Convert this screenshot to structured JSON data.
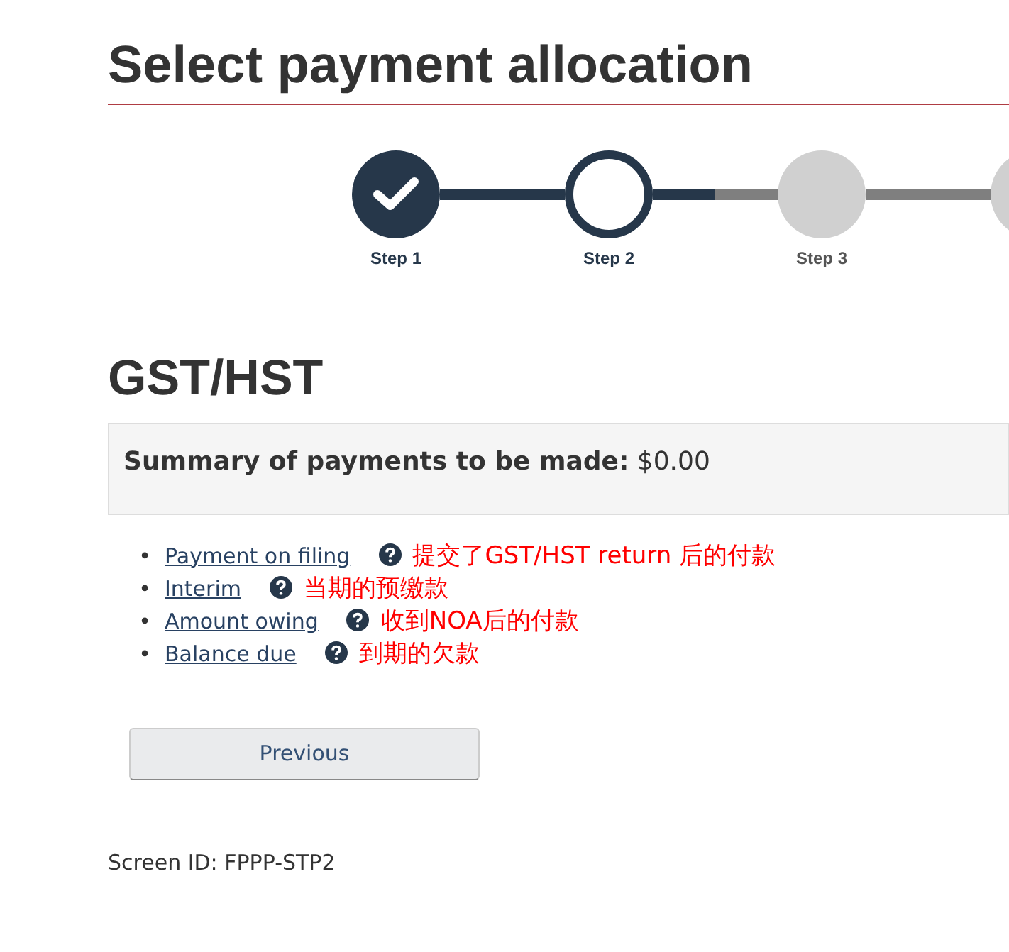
{
  "title": "Select payment allocation",
  "steps": [
    {
      "label": "Step 1",
      "completed": true,
      "reached": true
    },
    {
      "label": "Step 2",
      "completed": false,
      "reached": true
    },
    {
      "label": "Step 3",
      "completed": false,
      "reached": false
    },
    {
      "completed": false,
      "reached": false
    }
  ],
  "section_title": "GST/HST",
  "summary": {
    "label": "Summary of payments to be made:",
    "amount": "$0.00"
  },
  "payment_types": [
    {
      "bullet": "•",
      "label": "Payment on filing",
      "note": "提交了GST/HST return 后的付款"
    },
    {
      "bullet": "•",
      "label": "Interim",
      "note": "当期的预缴款"
    },
    {
      "bullet": "•",
      "label": "Amount owing",
      "note": "收到NOA后的付款"
    },
    {
      "bullet": "•",
      "label": "Balance due",
      "note": "到期的欠款"
    }
  ],
  "buttons": [
    {
      "label": "Previous"
    }
  ],
  "screen_id": "Screen ID: FPPP-STP2"
}
